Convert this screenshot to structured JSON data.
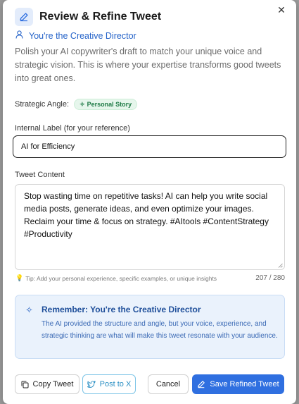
{
  "modal": {
    "title": "Review & Refine Tweet",
    "role": "You're the Creative Director",
    "description": "Polish your AI copywriter's draft to match your unique voice and strategic vision. This is where your expertise transforms good tweets into great ones.",
    "close_icon": "close-icon"
  },
  "angle": {
    "label": "Strategic Angle:",
    "badge": "Personal Story"
  },
  "internal_label": {
    "label": "Internal Label (for your reference)",
    "value": "AI for Efficiency"
  },
  "tweet": {
    "label": "Tweet Content",
    "value": "Stop wasting time on repetitive tasks! AI can help you write social media posts, generate ideas, and even optimize your images. Reclaim your time & focus on strategy. #AItools #ContentStrategy #Productivity",
    "tip": "Tip: Add your personal experience, specific examples, or unique insights",
    "counter": "207 / 280"
  },
  "reminder": {
    "title": "Remember: You're the Creative Director",
    "text": "The AI provided the structure and angle, but your voice, experience, and strategic thinking are what will make this tweet resonate with your audience."
  },
  "actions": {
    "copy_label": "Copy Tweet",
    "post_label": "Post to X",
    "cancel_label": "Cancel",
    "save_label": "Save Refined Tweet"
  },
  "colors": {
    "accent": "#2f6fe0",
    "role_text": "#2563c9",
    "badge_bg": "#e6f6ec",
    "badge_text": "#1e7a45",
    "reminder_bg": "#eaf2fc"
  }
}
